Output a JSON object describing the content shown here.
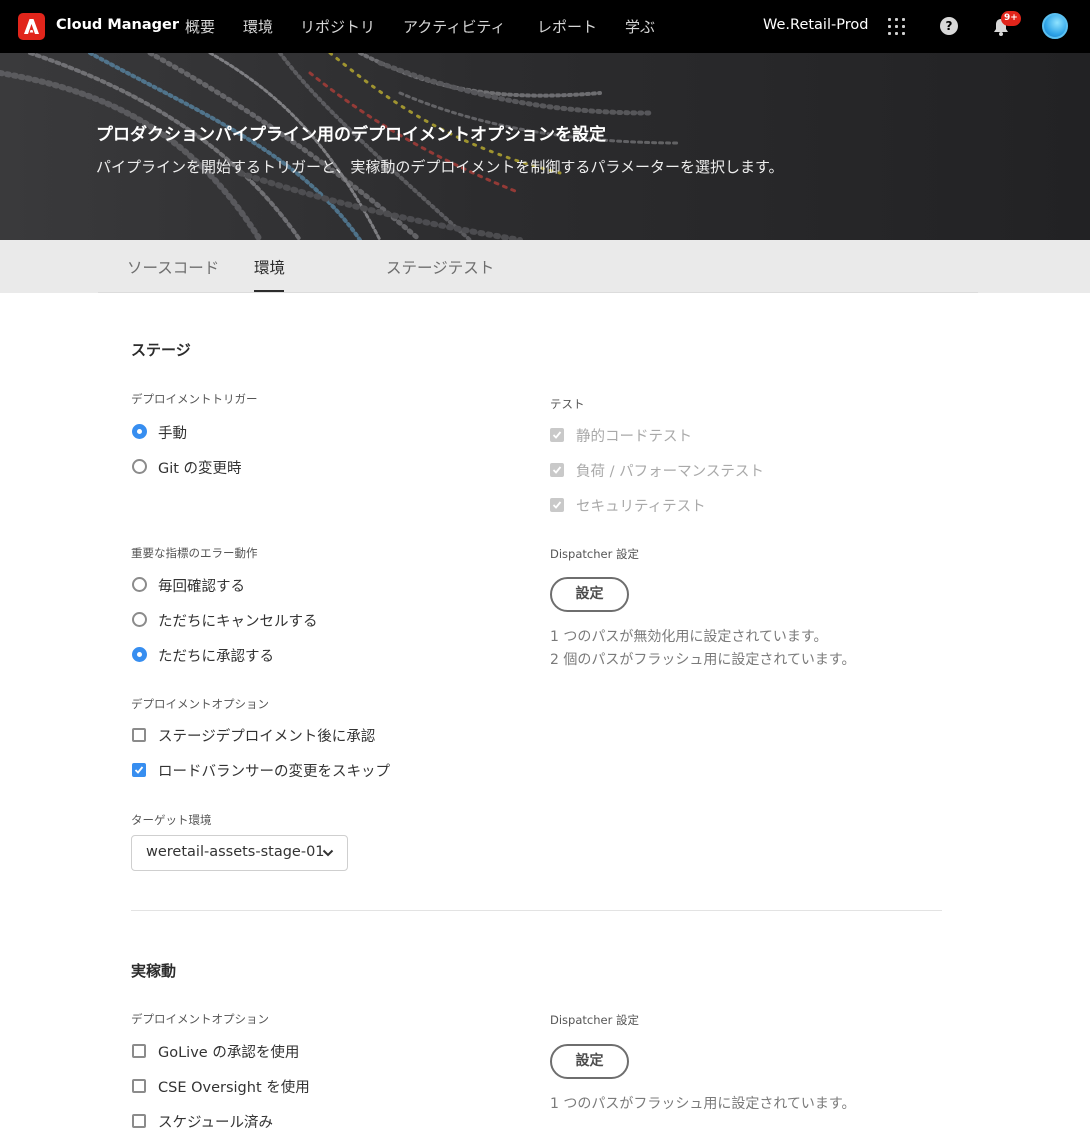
{
  "topnav": {
    "brand": "Cloud Manager",
    "items": [
      "概要",
      "環境",
      "リポジトリ",
      "アクティビティ",
      "レポート",
      "学ぶ"
    ],
    "org": "We.Retail-Prod",
    "notification_count": "9+"
  },
  "hero": {
    "title": "プロダクションパイプライン用のデプロイメントオプションを設定",
    "subtitle": "パイプラインを開始するトリガーと、実稼動のデプロイメントを制御するパラメーターを選択します。"
  },
  "tabs": [
    {
      "label": "ソースコード",
      "active": false
    },
    {
      "label": "環境",
      "active": true
    },
    {
      "label": "ステージテスト",
      "active": false
    }
  ],
  "stage": {
    "title": "ステージ",
    "trigger": {
      "label": "デプロイメントトリガー",
      "options": [
        {
          "label": "手動",
          "selected": true
        },
        {
          "label": "Git の変更時",
          "selected": false
        }
      ]
    },
    "tests": {
      "label": "テスト",
      "options": [
        {
          "label": "静的コードテスト",
          "checked": true,
          "disabled": true
        },
        {
          "label": "負荷 / パフォーマンステスト",
          "checked": true,
          "disabled": true
        },
        {
          "label": "セキュリティテスト",
          "checked": true,
          "disabled": true
        }
      ]
    },
    "metrics_error": {
      "label": "重要な指標のエラー動作",
      "options": [
        {
          "label": "毎回確認する",
          "selected": false
        },
        {
          "label": "ただちにキャンセルする",
          "selected": false
        },
        {
          "label": "ただちに承認する",
          "selected": true
        }
      ]
    },
    "dispatcher": {
      "label": "Dispatcher 設定",
      "button": "設定",
      "info": [
        "1 つのパスが無効化用に設定されています。",
        "2 個のパスがフラッシュ用に設定されています。"
      ]
    },
    "deploy_options": {
      "label": "デプロイメントオプション",
      "options": [
        {
          "label": "ステージデプロイメント後に承認",
          "checked": false
        },
        {
          "label": "ロードバランサーの変更をスキップ",
          "checked": true
        }
      ]
    },
    "target_env": {
      "label": "ターゲット環境",
      "value": "weretail-assets-stage-01"
    }
  },
  "production": {
    "title": "実稼動",
    "deploy_options": {
      "label": "デプロイメントオプション",
      "options": [
        {
          "label": "GoLive の承認を使用",
          "checked": false
        },
        {
          "label": "CSE Oversight を使用",
          "checked": false
        },
        {
          "label": "スケジュール済み",
          "checked": false
        }
      ]
    },
    "dispatcher": {
      "label": "Dispatcher 設定",
      "button": "設定",
      "info": [
        "1 つのパスがフラッシュ用に設定されています。"
      ]
    }
  },
  "colors": {
    "accent": "#378ef0",
    "brand": "#e1251b",
    "topbar": "#000000"
  }
}
